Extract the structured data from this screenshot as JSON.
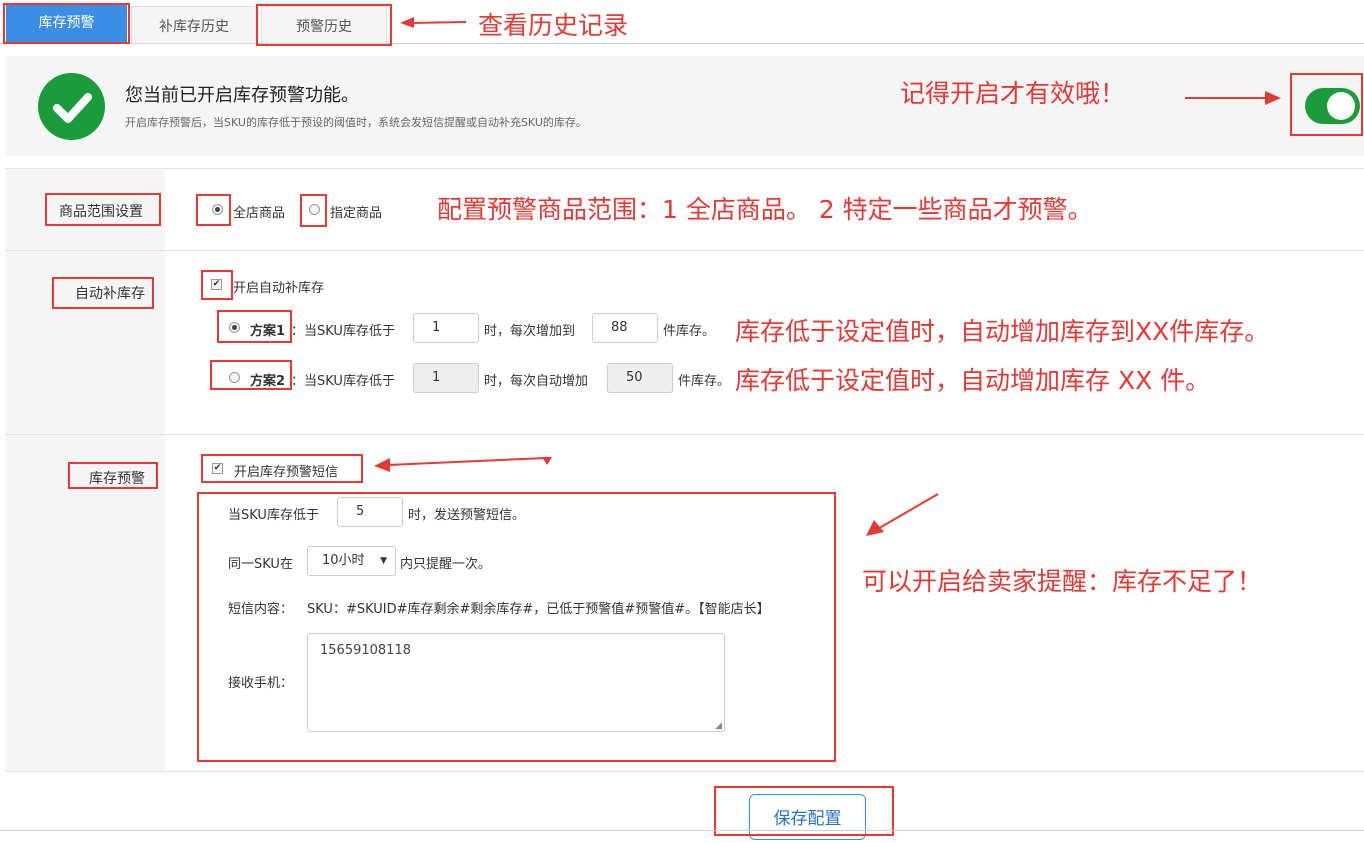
{
  "tabs": [
    {
      "label": "库存预警"
    },
    {
      "label": "补库存历史"
    },
    {
      "label": "预警历史"
    }
  ],
  "notice": {
    "title": "您当前已开启库存预警功能。",
    "desc": "开启库存预警后，当SKU的库存低于预设的阈值时，系统会发短信提醒或自动补充SKU的库存。",
    "toggle_on": true
  },
  "scope": {
    "label": "商品范围设置",
    "options": [
      {
        "label": "全店商品",
        "checked": true
      },
      {
        "label": "指定商品",
        "checked": false
      }
    ]
  },
  "auto_restock": {
    "label": "自动补库存",
    "enable_label": "开启自动补库存",
    "plan1": {
      "name": "方案1",
      "text_a": "：当SKU库存低于",
      "threshold": "1",
      "text_b": "时，每次增加到",
      "amount": "88",
      "text_c": "件库存。"
    },
    "plan2": {
      "name": "方案2",
      "text_a": "：当SKU库存低于",
      "threshold": "1",
      "text_b": "时，每次自动增加",
      "amount": "50",
      "text_c": "件库存。"
    }
  },
  "alert": {
    "label": "库存预警",
    "enable_label": "开启库存预警短信",
    "row1_a": "当SKU库存低于",
    "row1_value": "5",
    "row1_b": "时，发送预警短信。",
    "row2_a": "同一SKU在",
    "row2_select": "10小时",
    "row2_b": "内只提醒一次。",
    "sms_label": "短信内容：",
    "sms_content": "SKU：#SKUID#库存剩余#剩余库存#，已低于预警值#预警值#。【智能店长】",
    "phone_label": "接收手机：",
    "phone_value": "15659108118"
  },
  "save_button": "保存配置",
  "annotations": {
    "history": "查看历史记录",
    "toggle": "记得开启才有效哦！",
    "scope": "配置预警商品范围：1 全店商品。 2 特定一些商品才预警。",
    "plan1": "库存低于设定值时，自动增加库存到XX件库存。",
    "plan2": "库存低于设定值时，自动增加库存 XX 件。",
    "alert": "可以开启给卖家提醒：库存不足了！"
  },
  "colors": {
    "accent_blue": "#3a8ee6",
    "annotation_red": "#e53935",
    "check_green": "#1a9b3c"
  }
}
